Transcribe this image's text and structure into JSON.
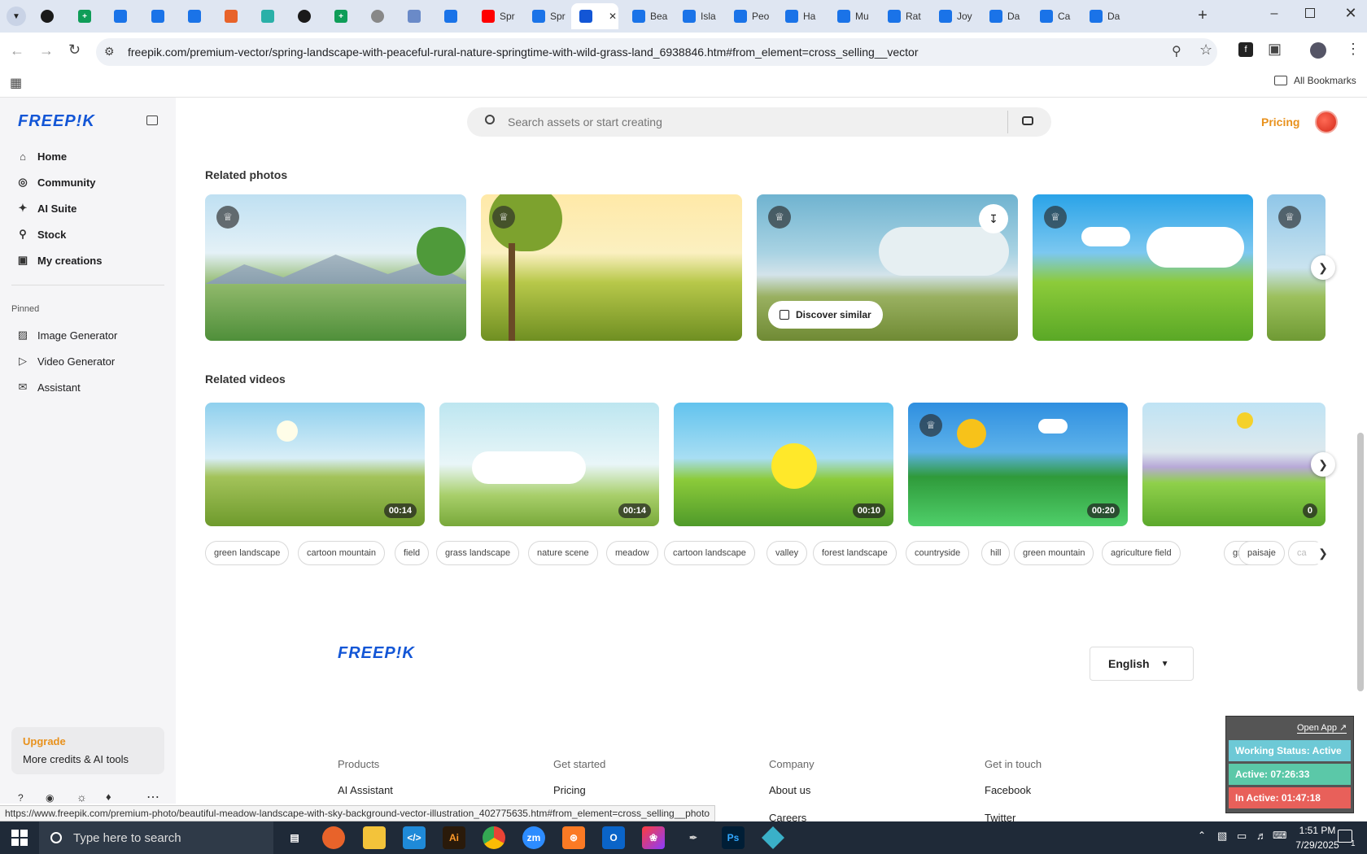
{
  "tabs": [
    {
      "title": ""
    },
    {
      "title": ""
    },
    {
      "title": ""
    },
    {
      "title": ""
    },
    {
      "title": ""
    },
    {
      "title": ""
    },
    {
      "title": ""
    },
    {
      "title": ""
    },
    {
      "title": ""
    },
    {
      "title": ""
    },
    {
      "title": ""
    },
    {
      "title": ""
    },
    {
      "title": "Spr"
    },
    {
      "title": "Spr"
    },
    {
      "title": ""
    },
    {
      "title": "Bea"
    },
    {
      "title": "Isla"
    },
    {
      "title": "Peo"
    },
    {
      "title": "Ha"
    },
    {
      "title": "Mu"
    },
    {
      "title": "Rat"
    },
    {
      "title": "Joy"
    },
    {
      "title": "Da"
    },
    {
      "title": "Ca"
    },
    {
      "title": "Da"
    }
  ],
  "browser": {
    "url": "freepik.com/premium-vector/spring-landscape-with-peaceful-rural-nature-springtime-with-wild-grass-land_6938846.htm#from_element=cross_selling__vector",
    "all_bookmarks": "All Bookmarks",
    "status_url": "https://www.freepik.com/premium-photo/beautiful-meadow-landscape-with-sky-background-vector-illustration_402775635.htm#from_element=cross_selling__photo"
  },
  "sidebar": {
    "logo": "FREEP!K",
    "items": [
      {
        "label": "Home",
        "icon": "home-icon"
      },
      {
        "label": "Community",
        "icon": "globe-icon"
      },
      {
        "label": "AI Suite",
        "icon": "sparkle-icon"
      },
      {
        "label": "Stock",
        "icon": "search-icon"
      },
      {
        "label": "My creations",
        "icon": "folder-icon"
      }
    ],
    "pinned_label": "Pinned",
    "pinned": [
      {
        "label": "Image Generator",
        "icon": "image-icon"
      },
      {
        "label": "Video Generator",
        "icon": "video-icon"
      },
      {
        "label": "Assistant",
        "icon": "chat-icon"
      }
    ],
    "upgrade": {
      "title": "Upgrade",
      "subtitle": "More credits & AI tools"
    }
  },
  "header": {
    "search_placeholder": "Search assets or start creating",
    "pricing": "Pricing"
  },
  "related_photos": {
    "title": "Related photos",
    "discover_similar": "Discover similar"
  },
  "related_videos": {
    "title": "Related videos",
    "durations": [
      "00:14",
      "00:14",
      "00:10",
      "00:20",
      "0"
    ]
  },
  "tags": [
    "green landscape",
    "cartoon mountain",
    "field",
    "grass landscape",
    "nature scene",
    "meadow",
    "cartoon landscape",
    "valley",
    "forest landscape",
    "countryside",
    "hill",
    "green mountain",
    "agriculture field",
    "grass",
    "paisaje",
    "ca"
  ],
  "footer": {
    "logo": "FREEP!K",
    "language": "English",
    "columns": [
      {
        "heading": "Products",
        "links": [
          "AI Assistant"
        ]
      },
      {
        "heading": "Get started",
        "links": [
          "Pricing"
        ]
      },
      {
        "heading": "Company",
        "links": [
          "About us",
          "Careers"
        ]
      },
      {
        "heading": "Get in touch",
        "links": [
          "Facebook",
          "Twitter"
        ]
      }
    ]
  },
  "widget": {
    "open_app": "Open App ↗",
    "working_status": "Working Status: Active",
    "active": "Active: 07:26:33",
    "inactive": "In Active: 01:47:18"
  },
  "taskbar": {
    "search_placeholder": "Type here to search",
    "time": "1:51 PM",
    "date": "7/29/2025",
    "notification_count": "1"
  },
  "colors": {
    "brand": "#1356d6",
    "accent_orange": "#e8911c",
    "widget_active": "#5bc8a8",
    "widget_status": "#6dc9d6",
    "widget_inactive": "#e8605a"
  }
}
